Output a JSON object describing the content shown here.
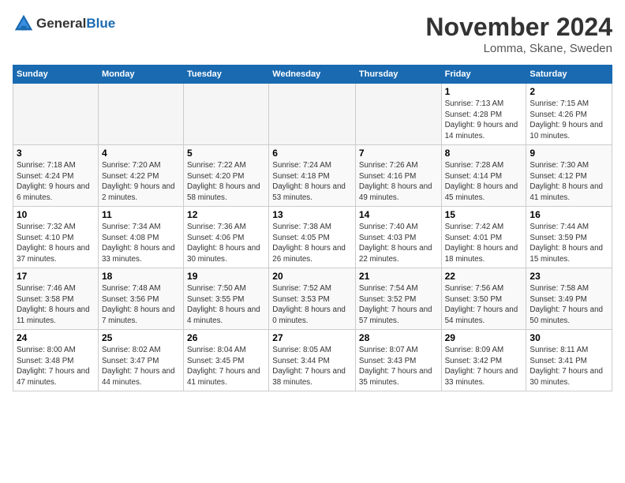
{
  "header": {
    "logo_line1": "General",
    "logo_line2": "Blue",
    "month": "November 2024",
    "location": "Lomma, Skane, Sweden"
  },
  "days_of_week": [
    "Sunday",
    "Monday",
    "Tuesday",
    "Wednesday",
    "Thursday",
    "Friday",
    "Saturday"
  ],
  "weeks": [
    {
      "days": [
        {
          "num": "",
          "info": ""
        },
        {
          "num": "",
          "info": ""
        },
        {
          "num": "",
          "info": ""
        },
        {
          "num": "",
          "info": ""
        },
        {
          "num": "",
          "info": ""
        },
        {
          "num": "1",
          "info": "Sunrise: 7:13 AM\nSunset: 4:28 PM\nDaylight: 9 hours and 14 minutes."
        },
        {
          "num": "2",
          "info": "Sunrise: 7:15 AM\nSunset: 4:26 PM\nDaylight: 9 hours and 10 minutes."
        }
      ]
    },
    {
      "days": [
        {
          "num": "3",
          "info": "Sunrise: 7:18 AM\nSunset: 4:24 PM\nDaylight: 9 hours and 6 minutes."
        },
        {
          "num": "4",
          "info": "Sunrise: 7:20 AM\nSunset: 4:22 PM\nDaylight: 9 hours and 2 minutes."
        },
        {
          "num": "5",
          "info": "Sunrise: 7:22 AM\nSunset: 4:20 PM\nDaylight: 8 hours and 58 minutes."
        },
        {
          "num": "6",
          "info": "Sunrise: 7:24 AM\nSunset: 4:18 PM\nDaylight: 8 hours and 53 minutes."
        },
        {
          "num": "7",
          "info": "Sunrise: 7:26 AM\nSunset: 4:16 PM\nDaylight: 8 hours and 49 minutes."
        },
        {
          "num": "8",
          "info": "Sunrise: 7:28 AM\nSunset: 4:14 PM\nDaylight: 8 hours and 45 minutes."
        },
        {
          "num": "9",
          "info": "Sunrise: 7:30 AM\nSunset: 4:12 PM\nDaylight: 8 hours and 41 minutes."
        }
      ]
    },
    {
      "days": [
        {
          "num": "10",
          "info": "Sunrise: 7:32 AM\nSunset: 4:10 PM\nDaylight: 8 hours and 37 minutes."
        },
        {
          "num": "11",
          "info": "Sunrise: 7:34 AM\nSunset: 4:08 PM\nDaylight: 8 hours and 33 minutes."
        },
        {
          "num": "12",
          "info": "Sunrise: 7:36 AM\nSunset: 4:06 PM\nDaylight: 8 hours and 30 minutes."
        },
        {
          "num": "13",
          "info": "Sunrise: 7:38 AM\nSunset: 4:05 PM\nDaylight: 8 hours and 26 minutes."
        },
        {
          "num": "14",
          "info": "Sunrise: 7:40 AM\nSunset: 4:03 PM\nDaylight: 8 hours and 22 minutes."
        },
        {
          "num": "15",
          "info": "Sunrise: 7:42 AM\nSunset: 4:01 PM\nDaylight: 8 hours and 18 minutes."
        },
        {
          "num": "16",
          "info": "Sunrise: 7:44 AM\nSunset: 3:59 PM\nDaylight: 8 hours and 15 minutes."
        }
      ]
    },
    {
      "days": [
        {
          "num": "17",
          "info": "Sunrise: 7:46 AM\nSunset: 3:58 PM\nDaylight: 8 hours and 11 minutes."
        },
        {
          "num": "18",
          "info": "Sunrise: 7:48 AM\nSunset: 3:56 PM\nDaylight: 8 hours and 7 minutes."
        },
        {
          "num": "19",
          "info": "Sunrise: 7:50 AM\nSunset: 3:55 PM\nDaylight: 8 hours and 4 minutes."
        },
        {
          "num": "20",
          "info": "Sunrise: 7:52 AM\nSunset: 3:53 PM\nDaylight: 8 hours and 0 minutes."
        },
        {
          "num": "21",
          "info": "Sunrise: 7:54 AM\nSunset: 3:52 PM\nDaylight: 7 hours and 57 minutes."
        },
        {
          "num": "22",
          "info": "Sunrise: 7:56 AM\nSunset: 3:50 PM\nDaylight: 7 hours and 54 minutes."
        },
        {
          "num": "23",
          "info": "Sunrise: 7:58 AM\nSunset: 3:49 PM\nDaylight: 7 hours and 50 minutes."
        }
      ]
    },
    {
      "days": [
        {
          "num": "24",
          "info": "Sunrise: 8:00 AM\nSunset: 3:48 PM\nDaylight: 7 hours and 47 minutes."
        },
        {
          "num": "25",
          "info": "Sunrise: 8:02 AM\nSunset: 3:47 PM\nDaylight: 7 hours and 44 minutes."
        },
        {
          "num": "26",
          "info": "Sunrise: 8:04 AM\nSunset: 3:45 PM\nDaylight: 7 hours and 41 minutes."
        },
        {
          "num": "27",
          "info": "Sunrise: 8:05 AM\nSunset: 3:44 PM\nDaylight: 7 hours and 38 minutes."
        },
        {
          "num": "28",
          "info": "Sunrise: 8:07 AM\nSunset: 3:43 PM\nDaylight: 7 hours and 35 minutes."
        },
        {
          "num": "29",
          "info": "Sunrise: 8:09 AM\nSunset: 3:42 PM\nDaylight: 7 hours and 33 minutes."
        },
        {
          "num": "30",
          "info": "Sunrise: 8:11 AM\nSunset: 3:41 PM\nDaylight: 7 hours and 30 minutes."
        }
      ]
    }
  ]
}
